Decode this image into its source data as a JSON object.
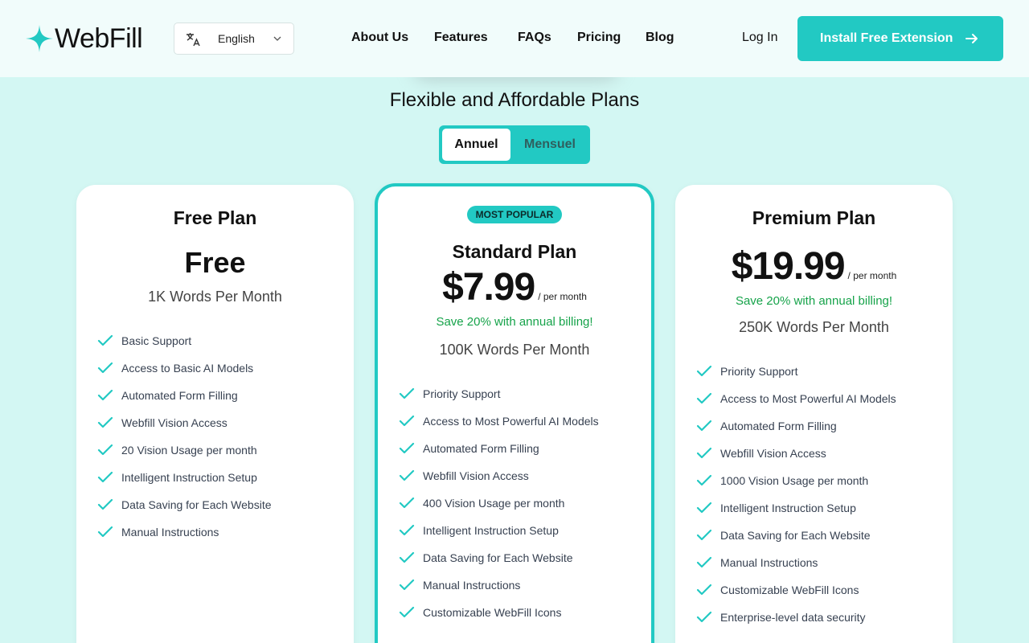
{
  "header": {
    "logo_text": "WebFill",
    "language": "English",
    "nav": [
      "About Us",
      "Features",
      "FAQs",
      "Pricing",
      "Blog"
    ],
    "login": "Log In",
    "install": "Install Free Extension"
  },
  "section": {
    "title": "Flexible and Affordable Plans",
    "toggle": {
      "annual": "Annuel",
      "monthly": "Mensuel"
    }
  },
  "colors": {
    "accent": "#22c9c3",
    "green": "#16a34a",
    "background": "#d3f7f3"
  },
  "plans": {
    "free": {
      "name": "Free Plan",
      "price": "Free",
      "words": "1K Words Per Month",
      "features": [
        "Basic Support",
        "Access to Basic AI Models",
        "Automated Form Filling",
        "Webfill Vision Access",
        "20 Vision Usage per month",
        "Intelligent Instruction Setup",
        "Data Saving for Each Website",
        "Manual Instructions"
      ]
    },
    "standard": {
      "badge": "MOST POPULAR",
      "name": "Standard Plan",
      "price": "$7.99",
      "per": "/ per month",
      "save": "Save 20% with annual billing!",
      "words": "100K Words Per Month",
      "features": [
        "Priority Support",
        "Access to Most Powerful AI Models",
        "Automated Form Filling",
        "Webfill Vision Access",
        "400 Vision Usage per month",
        "Intelligent Instruction Setup",
        "Data Saving for Each Website",
        "Manual Instructions",
        "Customizable WebFill Icons"
      ]
    },
    "premium": {
      "name": "Premium Plan",
      "price": "$19.99",
      "per": "/ per month",
      "save": "Save 20% with annual billing!",
      "words": "250K Words Per Month",
      "features": [
        "Priority Support",
        "Access to Most Powerful AI Models",
        "Automated Form Filling",
        "Webfill Vision Access",
        "1000 Vision Usage per month",
        "Intelligent Instruction Setup",
        "Data Saving for Each Website",
        "Manual Instructions",
        "Customizable WebFill Icons",
        "Enterprise-level data security"
      ]
    }
  }
}
